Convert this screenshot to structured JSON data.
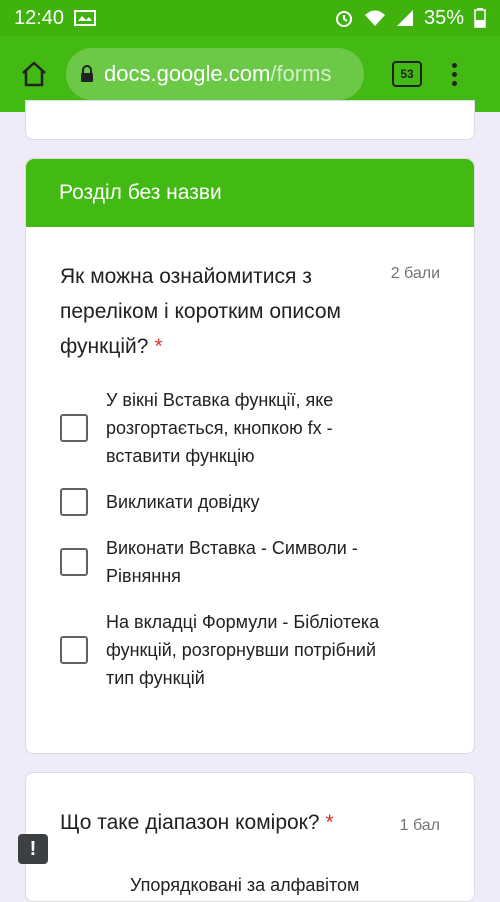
{
  "status_bar": {
    "time": "12:40",
    "battery_percent": "35%"
  },
  "browser": {
    "url_domain": "docs.google.com",
    "url_path": "/forms",
    "tab_count": "53"
  },
  "section": {
    "title": "Розділ без назви"
  },
  "question1": {
    "title": "Як можна ознайомитися з переліком і коротким описом функцій?",
    "required_mark": "*",
    "points": "2 бали",
    "options": [
      "У вікні Вставка функції, яке розгортається, кнопкою fx - вставити функцію",
      "Викликати довідку",
      "Виконати Вставка - Символи - Рівняння",
      "На вкладці Формули - Бібліотека функцій, розгорнувши потрібний тип функцій"
    ]
  },
  "question2": {
    "title": "Що таке діапазон комірок?",
    "required_mark": "*",
    "points": "1 бал",
    "first_option_partial": "Упорядковані за алфавітом"
  },
  "colors": {
    "accent": "#43b914",
    "status_bar": "#3fb20e",
    "background": "#f0ebf8",
    "required": "#d93025"
  },
  "icons": [
    "screenshot-icon",
    "alarm-icon",
    "wifi-icon",
    "signal-icon",
    "battery-icon",
    "home-icon",
    "lock-icon",
    "menu-icon",
    "feedback-icon"
  ]
}
